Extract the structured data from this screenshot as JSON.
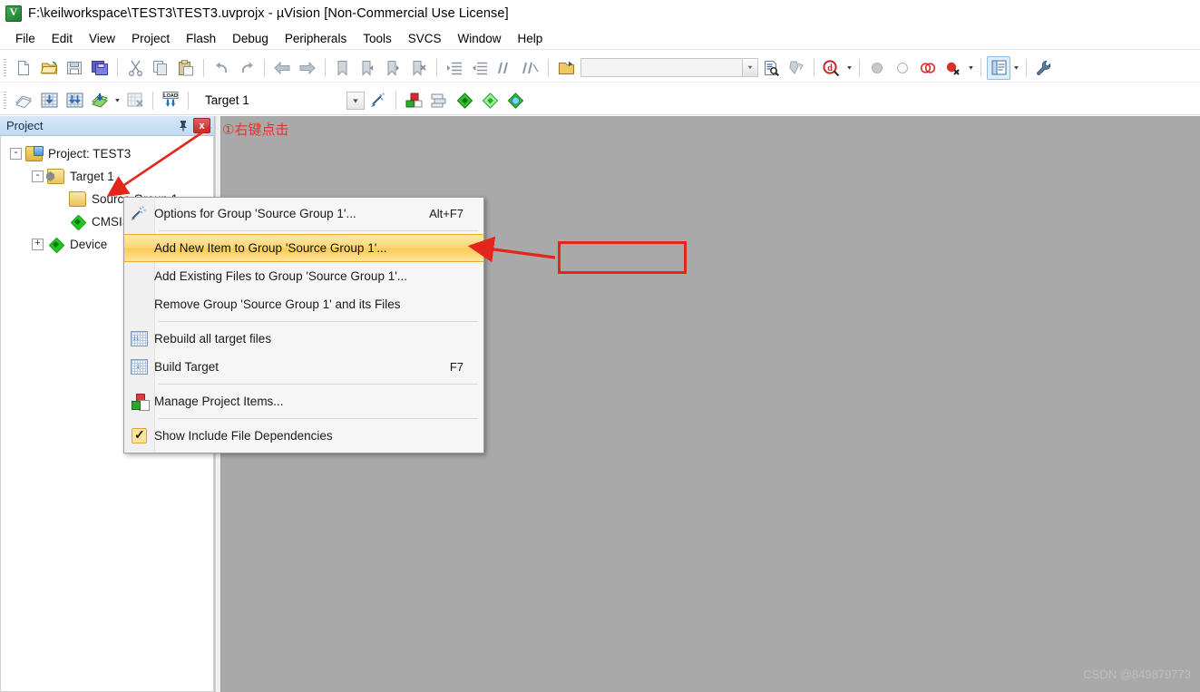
{
  "window": {
    "title": "F:\\keilworkspace\\TEST3\\TEST3.uvprojx - µVision  [Non-Commercial Use License]",
    "app_icon": "keil-uvision-icon"
  },
  "menubar": {
    "items": [
      {
        "label": "File"
      },
      {
        "label": "Edit"
      },
      {
        "label": "View"
      },
      {
        "label": "Project"
      },
      {
        "label": "Flash"
      },
      {
        "label": "Debug"
      },
      {
        "label": "Peripherals"
      },
      {
        "label": "Tools"
      },
      {
        "label": "SVCS"
      },
      {
        "label": "Window"
      },
      {
        "label": "Help"
      }
    ]
  },
  "toolbar_file": {
    "buttons": [
      {
        "name": "new-file-icon"
      },
      {
        "name": "open-file-icon"
      },
      {
        "name": "save-icon"
      },
      {
        "name": "save-all-icon"
      },
      {
        "name": "cut-icon"
      },
      {
        "name": "copy-icon"
      },
      {
        "name": "paste-icon"
      },
      {
        "name": "undo-icon"
      },
      {
        "name": "redo-icon"
      },
      {
        "name": "navigate-back-icon"
      },
      {
        "name": "navigate-forward-icon"
      },
      {
        "name": "bookmark-toggle-icon"
      },
      {
        "name": "bookmark-prev-icon"
      },
      {
        "name": "bookmark-next-icon"
      },
      {
        "name": "bookmark-clear-icon"
      },
      {
        "name": "indent-icon"
      },
      {
        "name": "outdent-icon"
      },
      {
        "name": "comment-icon"
      },
      {
        "name": "uncomment-icon"
      },
      {
        "name": "open-folder-browse-icon"
      }
    ],
    "search_combo": {
      "value": "",
      "placeholder": ""
    },
    "find-in-files-icon": "find-in-files-icon",
    "bookmark-tool-icon": "bookmark-tool-icon",
    "debug_icon": "start-debug-icon",
    "insert-breakpoint-icon": "insert-breakpoint-icon",
    "enable-breakpoint-icon": "enable-breakpoint-icon",
    "disable-all-breakpoints-icon": "disable-all-breakpoints-icon",
    "kill-all-breakpoints-icon": "kill-all-breakpoints-icon",
    "project-window-icon": "project-window-icon",
    "configure-icon": "configure-wrench-icon"
  },
  "toolbar_build": {
    "buttons": [
      {
        "name": "translate-file-icon"
      },
      {
        "name": "build-target-icon"
      },
      {
        "name": "rebuild-all-icon"
      },
      {
        "name": "batch-build-icon"
      },
      {
        "name": "stop-build-icon"
      },
      {
        "name": "download-to-flash-icon"
      }
    ],
    "target_select": {
      "value": "Target 1"
    },
    "target_options_icon": "target-options-icon",
    "manage_items_icon": "manage-project-items-icon",
    "multi_project_icon": "multi-project-icon",
    "pack_installer_icon": "pack-installer-icon",
    "manage_rte_icon": "manage-run-time-environment-icon",
    "select_swpack_icon": "select-software-packs-icon"
  },
  "project_panel": {
    "title": "Project",
    "pin_icon": "pin-icon",
    "close_icon": "close-icon",
    "tree": [
      {
        "label": "Project: TEST3",
        "icon": "project-icon",
        "level": 0,
        "expander": "-"
      },
      {
        "label": "Target 1",
        "icon": "target-folder-icon",
        "level": 1,
        "expander": "-"
      },
      {
        "label": "Source Group 1",
        "icon": "folder-icon",
        "level": 2,
        "expander": ""
      },
      {
        "label": "CMSIS",
        "icon": "component-icon",
        "level": 2,
        "expander": ""
      },
      {
        "label": "Device",
        "icon": "component-icon",
        "level": 2,
        "expander": "+"
      }
    ]
  },
  "context_menu": {
    "items": [
      {
        "label": "Options for Group 'Source Group 1'...",
        "accel": "Alt+F7",
        "icon": "options-wand-icon",
        "selected": false,
        "sep_after": true
      },
      {
        "label": "Add New  Item to Group 'Source Group 1'...",
        "accel": "",
        "icon": "",
        "selected": true,
        "sep_after": false
      },
      {
        "label": "Add Existing Files to Group 'Source Group 1'...",
        "accel": "",
        "icon": "",
        "selected": false,
        "sep_after": false
      },
      {
        "label": "Remove Group 'Source Group 1' and its Files",
        "accel": "",
        "icon": "",
        "selected": false,
        "sep_after": true
      },
      {
        "label": "Rebuild all target files",
        "accel": "",
        "icon": "rebuild-icon",
        "selected": false,
        "sep_after": false
      },
      {
        "label": "Build Target",
        "accel": "F7",
        "icon": "build-icon",
        "selected": false,
        "sep_after": true
      },
      {
        "label": "Manage Project Items...",
        "accel": "",
        "icon": "manage-items-icon",
        "selected": false,
        "sep_after": true
      },
      {
        "label": "Show Include File Dependencies",
        "accel": "",
        "icon": "checkmark-icon",
        "selected": false,
        "sep_after": false
      }
    ]
  },
  "annotations": {
    "step1_text": "①右键点击",
    "callout_box_text": "",
    "arrow_color": "#e4251c"
  },
  "watermark": {
    "text": "CSDN @849879773"
  },
  "colors": {
    "mdi_background": "#a9a9a9",
    "dock_title": "#c2daf1",
    "menu_highlight": "#fdd776",
    "annotation_red": "#e4251c",
    "close_button": "#c02c2c"
  }
}
